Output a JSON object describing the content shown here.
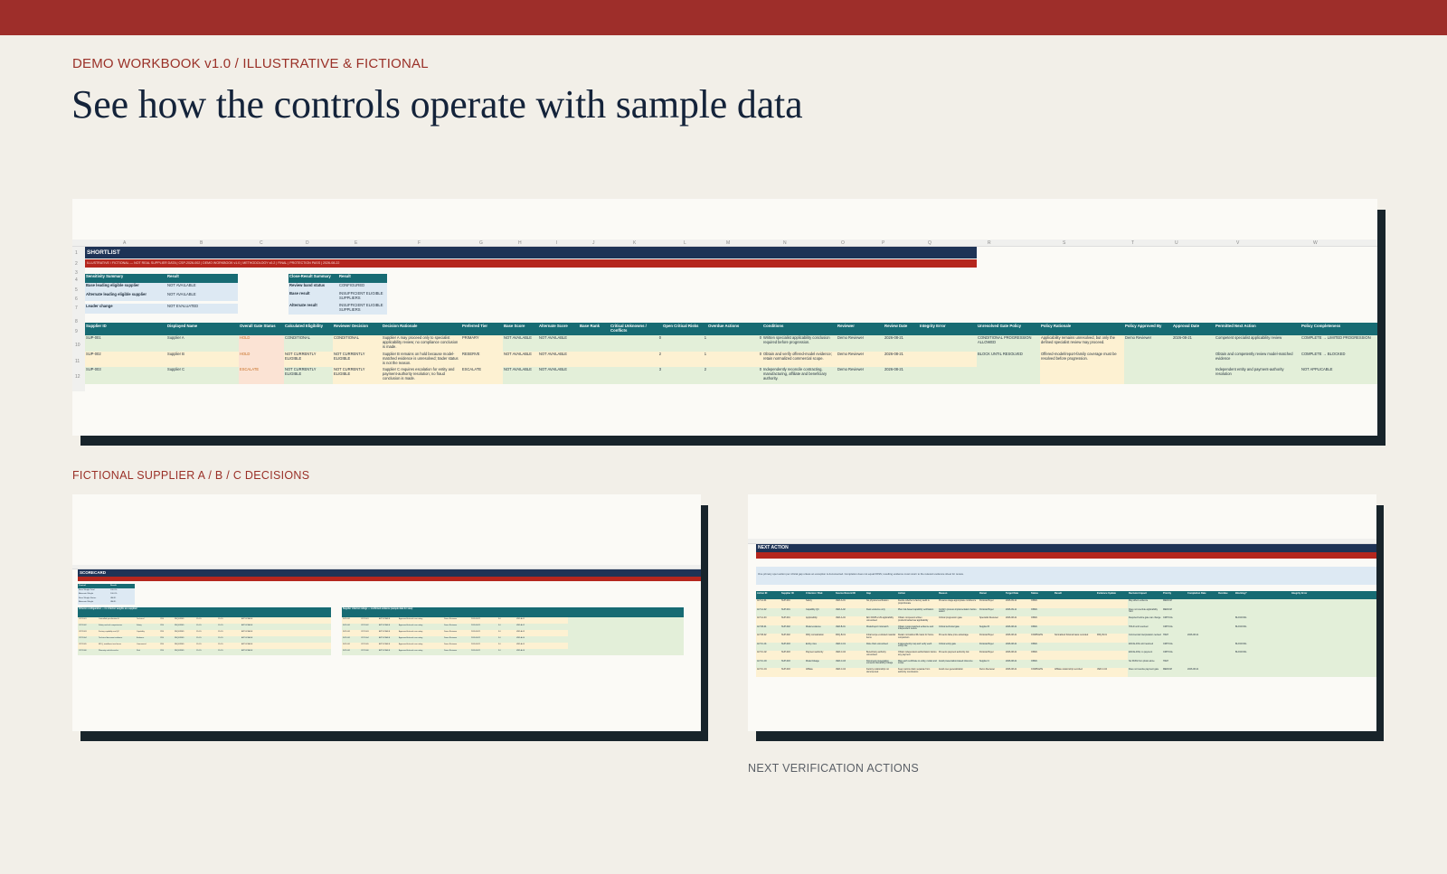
{
  "header": {
    "eyebrow": "DEMO WORKBOOK v1.0  /  ILLUSTRATIVE & FICTIONAL",
    "headline": "See how the controls operate with sample data"
  },
  "captions": {
    "left": "FICTIONAL SUPPLIER A / B / C DECISIONS",
    "right": "NEXT VERIFICATION ACTIONS"
  },
  "colors": {
    "brand": "#9e2e2a",
    "navy": "#1e3356",
    "teal": "#176b73",
    "red": "#b5261e"
  },
  "shortlist": {
    "title": "SHORTLIST",
    "subtitle": "ILLUSTRATIVE / FICTIONAL — NOT REAL SUPPLIER DATA  |  CSP-2026-002  |  DEMO WORKBOOK v1.0  |  METHODOLOGY v0.2  |  FINAL  |  PROTECTION PASS  |  2026-08-22",
    "col_letters": [
      "A",
      "B",
      "C",
      "D",
      "E",
      "F",
      "G",
      "H",
      "I",
      "J",
      "K",
      "L",
      "M",
      "N",
      "O",
      "P",
      "Q",
      "R",
      "S",
      "T",
      "U",
      "V",
      "W"
    ],
    "row_numbers": [
      "1",
      "2",
      "3",
      "4",
      "5",
      "6",
      "7",
      "8",
      "9",
      "10",
      "11",
      "12"
    ],
    "sensitivity": {
      "header": [
        "Sensitivity Summary",
        "Result"
      ],
      "rows": [
        [
          "Base leading eligible supplier",
          "NOT AVAILABLE"
        ],
        [
          "Alternate leading eligible supplier",
          "NOT AVAILABLE"
        ],
        [
          "Leader change",
          "NOT EVALUATED"
        ]
      ]
    },
    "close_result": {
      "header": [
        "Close-Result Summary",
        "Result"
      ],
      "rows": [
        [
          "Review band status",
          "CONFIGURED"
        ],
        [
          "Base result",
          "INSUFFICIENT ELIGIBLE SUPPLIERS"
        ],
        [
          "Alternate result",
          "INSUFFICIENT ELIGIBLE SUPPLIERS"
        ]
      ]
    },
    "table_headers": [
      "Supplier ID",
      "Displayed Name",
      "Overall Gate Status",
      "Calculated Eligibility",
      "Reviewer Decision",
      "Decision Rationale",
      "Preferred Tier",
      "Base Score",
      "Alternate Score",
      "Base Rank",
      "Critical Unknowns / Conflicts",
      "Open Critical Risks",
      "Overdue Actions",
      "Conditions",
      "Reviewer",
      "Review Date",
      "Integrity Error"
    ],
    "rows": [
      {
        "id": "SUP-001",
        "name": "Supplier A",
        "gate": "HOLD",
        "elig": "CONDITIONAL",
        "decision": "CONDITIONAL",
        "rationale": "Supplier A may proceed only to specialist applicability review; no compliance conclusion is made.",
        "tier": "PRIMARY",
        "base": "NOT AVAILABLE",
        "alt": "NOT AVAILABLE",
        "rank": "",
        "unknowns": "0",
        "risks": "1",
        "overdue": "0",
        "conditions": "Written specialist applicability conclusion required before progression.",
        "reviewer": "Demo Reviewer",
        "date": "2026-08-21",
        "error": ""
      },
      {
        "id": "SUP-002",
        "name": "Supplier B",
        "gate": "HOLD",
        "elig": "NOT CURRENTLY ELIGIBLE",
        "decision": "NOT CURRENTLY ELIGIBLE",
        "rationale": "Supplier B remains on hold because model-matched evidence is unresolved; trader status is not the reason.",
        "tier": "RESERVE",
        "base": "NOT AVAILABLE",
        "alt": "NOT AVAILABLE",
        "rank": "",
        "unknowns": "2",
        "risks": "1",
        "overdue": "0",
        "conditions": "Obtain and verify offered-model evidence; retain normalized commercial scope.",
        "reviewer": "Demo Reviewer",
        "date": "2026-08-21",
        "error": ""
      },
      {
        "id": "SUP-003",
        "name": "Supplier C",
        "gate": "ESCALATE",
        "elig": "NOT CURRENTLY ELIGIBLE",
        "decision": "NOT CURRENTLY ELIGIBLE",
        "rationale": "Supplier C requires escalation for entity and payment-authority resolution; no fraud conclusion is made.",
        "tier": "ESCALATE",
        "base": "NOT AVAILABLE",
        "alt": "NOT AVAILABLE",
        "rank": "",
        "unknowns": "3",
        "risks": "2",
        "overdue": "0",
        "conditions": "Independently reconcile contracting, manufacturing, affiliate and beneficiary authority.",
        "reviewer": "Demo Reviewer",
        "date": "2026-08-21",
        "error": ""
      }
    ],
    "policy_headers": [
      "Unresolved Gate Policy",
      "Policy Rationale",
      "Policy Approved By",
      "Approval Date",
      "Permitted Next Action",
      "Policy Completeness"
    ],
    "policy_rows": [
      [
        "CONDITIONAL PROGRESSION ALLOWED",
        "Applicability remains unresolved, but only the defined specialist review may proceed.",
        "Demo Reviewer",
        "2026-08-21",
        "Competent specialist applicability review",
        "COMPLETE → LIMITED PROGRESSION"
      ],
      [
        "BLOCK UNTIL RESOLVED",
        "Offered-model/report-family coverage must be resolved before progression.",
        "",
        "",
        "Obtain and competently review model-matched evidence",
        "COMPLETE → BLOCKED"
      ],
      [
        "",
        "",
        "",
        "",
        "Independent entity and payment-authority resolution",
        "NOT APPLICABLE"
      ]
    ]
  },
  "scorecard": {
    "title": "SCORECARD",
    "left_header": "Criterion configuration — no criterion weights are supplied",
    "right_header": "Supplier criterion ratings — confirmed evidence (sample data for view)",
    "summary": [
      [
        "Control",
        "Result"
      ],
      [
        "Base Weight Total",
        "100.0%"
      ],
      [
        "Alternate Weight",
        "100.0%"
      ],
      [
        "Base Weight Status",
        "VALID"
      ],
      [
        "Alternate Weight",
        "VALID"
      ]
    ],
    "left_rows": [
      [
        "CRIT-001",
        "Controlled specification fit",
        "Technical",
        "YES",
        "REQUIRED",
        "15.0%",
        "15.0%",
        "APPLICABLE"
      ],
      [
        "CRIT-002",
        "Safety and risk competencies",
        "Safety",
        "YES",
        "REQUIRED",
        "15.0%",
        "15.0%",
        "APPLICABLE"
      ],
      [
        "CRIT-003",
        "Factory capability and QC",
        "Capability",
        "YES",
        "REQUIRED",
        "15.0%",
        "15.0%",
        "APPLICABLE"
      ],
      [
        "CRIT-004",
        "Technical document evidence",
        "Evidence",
        "YES",
        "REQUIRED",
        "15.0%",
        "15.0%",
        "APPLICABLE"
      ],
      [
        "CRIT-005",
        "MOQ, installment and terms",
        "Commercial",
        "YES",
        "REQUIRED",
        "15.0%",
        "15.0%",
        "APPLICABLE"
      ],
      [
        "CRIT-006",
        "Warranty and after-sales",
        "Risk",
        "YES",
        "REQUIRED",
        "15.0%",
        "15.0%",
        "APPLICABLE"
      ]
    ],
    "right_rows": [
      [
        "SUP-001",
        "CRIT-001",
        "APPLICABLE",
        "Approved fictional case rating",
        "Demo Reviewer",
        "2026-08-21",
        "3.0",
        "VER-A-01"
      ],
      [
        "SUP-001",
        "CRIT-002",
        "APPLICABLE",
        "Approved fictional case rating",
        "Demo Reviewer",
        "2026-08-21",
        "3.0",
        "VER-A-02"
      ],
      [
        "SUP-001",
        "CRIT-003",
        "APPLICABLE",
        "Approved fictional case rating",
        "Demo Reviewer",
        "2026-08-21",
        "3.0",
        "VER-A-03"
      ],
      [
        "SUP-001",
        "CRIT-004",
        "APPLICABLE",
        "Approved fictional case rating",
        "Demo Reviewer",
        "2026-08-21",
        "3.0",
        "VER-A-04"
      ],
      [
        "SUP-001",
        "CRIT-005",
        "APPLICABLE",
        "Approved fictional case rating",
        "Demo Reviewer",
        "2026-08-21",
        "3.0",
        "VER-A-05"
      ],
      [
        "SUP-001",
        "CRIT-006",
        "APPLICABLE",
        "Approved fictional case rating",
        "Demo Reviewer",
        "2026-08-21",
        "3.0",
        "VER-A-06"
      ]
    ]
  },
  "next_action": {
    "title": "NEXT ACTION",
    "note": "One primary open action per critical gap unless an exception is documented. Completion does not equal PASS; resulting evidence must return to the relevant evidence sheet for review.",
    "headers": [
      "Action ID",
      "Supplier ID",
      "Criterion / Risk",
      "Source Record ID",
      "Gap",
      "Action",
      "Reason",
      "Owner",
      "Target Date",
      "Status",
      "Result",
      "Evidence Update",
      "Decision Impact",
      "Priority",
      "Completion Date",
      "Overdue",
      "Blocking?",
      "Integrity Error"
    ],
    "rows": [
      [
        "ACT-A-01",
        "SUP-001",
        "Safety",
        "VER-A-01",
        "No physical verification",
        "Decide whether a factory audit is proportionate",
        "Preserve stage-appropriate confidence",
        "Fictional Buyer",
        "2026-09-11",
        "OPEN",
        "",
        "",
        "May affect evidence",
        "MEDIUM",
        "",
        "",
        "",
        ""
      ],
      [
        "ACT-A-02",
        "SUP-001",
        "Capability QC",
        "VER-A-02",
        "Desk evidence only",
        "Plan risk-based capability verification",
        "Confirm process implementation before award",
        "Fictional Buyer",
        "2026-09-11",
        "OPEN",
        "",
        "",
        "Does not override applicability hold",
        "MEDIUM",
        "",
        "",
        "",
        ""
      ],
      [
        "ACT-A-04",
        "SUP-001",
        "Applicability",
        "VER-A-04",
        "IEC 60335-2-29 applicability unresolved",
        "Obtain competent written product/market law applicability",
        "Critical progression gate",
        "Specialist Reviewer",
        "2026-08-21",
        "OPEN",
        "",
        "",
        "Required before gate can change",
        "CRITICAL",
        "",
        "",
        "BLOCKING",
        ""
      ],
      [
        "ACT-B-01",
        "SUP-002",
        "Model evidence",
        "VER-B-01",
        "Model/report mismatch",
        "Obtain model-matched evidence and independent review",
        "Critical technical gate",
        "Supplier B",
        "2026-08-21",
        "OPEN",
        "",
        "",
        "HOLD until resolved",
        "CRITICAL",
        "",
        "",
        "BLOCKING",
        ""
      ],
      [
        "ACT-B-02",
        "SUP-002",
        "RFQ normalization",
        "RFQ-B-01",
        "Initial scope excluded material items",
        "Retain normalized RL basis for future comparison",
        "Prevents false price advantage",
        "Fictional Buyer",
        "2026-08-21",
        "COMPLETE",
        "Normalized fictional basis recorded",
        "RFQ-B-01",
        "Commercial interpretation revised",
        "HIGH",
        "2026-08-21",
        "",
        "",
        ""
      ],
      [
        "ACT-C-01",
        "SUP-003",
        "Entity roles",
        "VER-C-01",
        "Role chain unresolved",
        "Independently map and verify each entity role",
        "Critical entity gate",
        "Fictional Buyer",
        "2026-08-21",
        "OPEN",
        "",
        "",
        "ESCALATE until resolved",
        "CRITICAL",
        "",
        "",
        "BLOCKING",
        ""
      ],
      [
        "ACT-C-02",
        "SUP-003",
        "Payment authority",
        "VER-C-02",
        "Beneficiary authority unresolved",
        "Obtain independent authorization before any payment",
        "Prevents payment authority risk",
        "Fictional Buyer",
        "2026-08-21",
        "OPEN",
        "",
        "",
        "ESCALATE; no payment",
        "CRITICAL",
        "",
        "",
        "BLOCKING",
        ""
      ],
      [
        "ACT-C-03",
        "SUP-003",
        "Model linkage",
        "VER-C-03",
        "Document presentation exceeds traceability linkage",
        "Map each certificate to entity, model and scope",
        "Avoid presentation-based inference",
        "Supplier C",
        "2026-08-21",
        "OPEN",
        "",
        "",
        "No PASS from photo alone",
        "HIGH",
        "",
        "",
        "",
        ""
      ],
      [
        "ACT-C-04",
        "SUP-003",
        "Affiliate",
        "VER-C-04",
        "Factory relationship not documented",
        "Keep narrow claim separate from authority conclusions",
        "Avoid over-generalization",
        "Demo Reviewer",
        "2026-08-21",
        "COMPLETE",
        "Affiliate relationship recorded",
        "VER-C-04",
        "Does not resolve payment gate",
        "MEDIUM",
        "2026-08-21",
        "",
        "",
        ""
      ]
    ]
  }
}
